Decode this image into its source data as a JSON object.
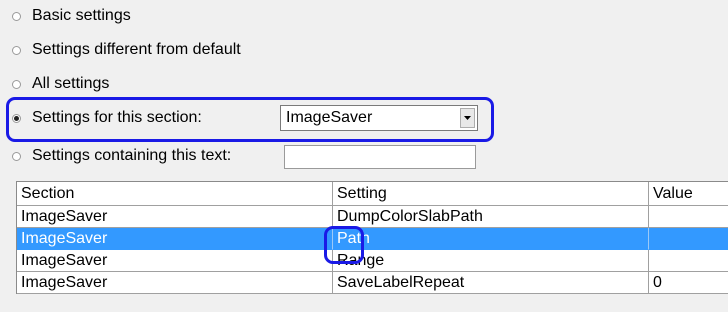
{
  "options": {
    "basic": "Basic settings",
    "different": "Settings different from default",
    "all": "All settings",
    "section": "Settings for this section:",
    "containing": "Settings containing this text:"
  },
  "section_select": {
    "value": "ImageSaver"
  },
  "search_field": {
    "value": ""
  },
  "table": {
    "columns": [
      "Section",
      "Setting",
      "Value"
    ],
    "rows": [
      {
        "section": "ImageSaver",
        "setting": "DumpColorSlabPath",
        "value": ""
      },
      {
        "section": "ImageSaver",
        "setting": "Path",
        "value": ""
      },
      {
        "section": "ImageSaver",
        "setting": "Range",
        "value": ""
      },
      {
        "section": "ImageSaver",
        "setting": "SaveLabelRepeat",
        "value": "0"
      }
    ]
  },
  "icons": {
    "dropdown": "chevron-down-icon"
  },
  "colors": {
    "selection": "#3399ff",
    "annotation": "#1a1ae6"
  }
}
